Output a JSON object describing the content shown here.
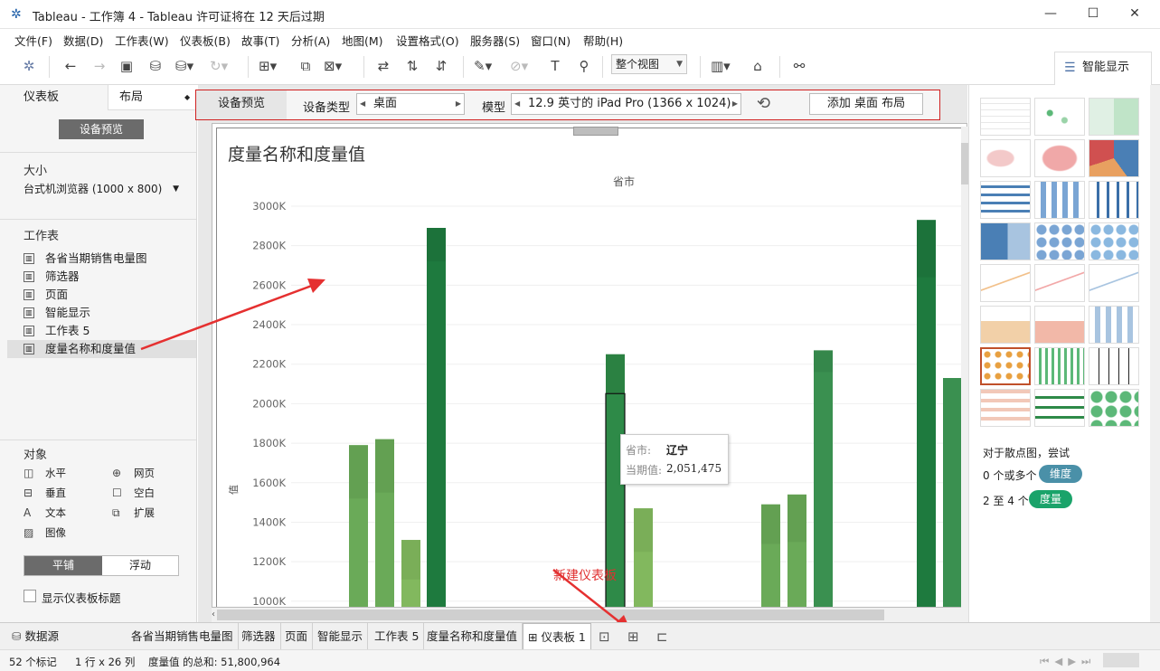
{
  "window": {
    "title": "Tableau - 工作簿 4 - Tableau 许可证将在 12 天后过期",
    "minimize": "—",
    "maximize": "☐",
    "close": "✕"
  },
  "menu": [
    "文件(F)",
    "数据(D)",
    "工作表(W)",
    "仪表板(B)",
    "故事(T)",
    "分析(A)",
    "地图(M)",
    "设置格式(O)",
    "服务器(S)",
    "窗口(N)",
    "帮助(H)"
  ],
  "toolbar": {
    "fit_label": "整个视图",
    "show_me_label": "智能显示"
  },
  "left_panel": {
    "tab_dashboard": "仪表板",
    "tab_layout": "布局",
    "device_preview_button": "设备预览",
    "size_heading": "大小",
    "size_value": "台式机浏览器 (1000 x 800)",
    "sheets_heading": "工作表",
    "sheets": [
      "各省当期销售电量图",
      "筛选器",
      "页面",
      "智能显示",
      "工作表 5",
      "度量名称和度量值"
    ],
    "objects_heading": "对象",
    "objects": [
      {
        "label": "水平",
        "icon": "horizontal-icon"
      },
      {
        "label": "网页",
        "icon": "web-icon"
      },
      {
        "label": "垂直",
        "icon": "vertical-icon"
      },
      {
        "label": "空白",
        "icon": "blank-icon"
      },
      {
        "label": "文本",
        "icon": "text-icon"
      },
      {
        "label": "扩展",
        "icon": "extension-icon"
      },
      {
        "label": "图像",
        "icon": "image-icon"
      }
    ],
    "tiled": "平铺",
    "floating": "浮动",
    "show_title": "显示仪表板标题"
  },
  "device_bar": {
    "tab": "设备预览",
    "type_label": "设备类型",
    "type_value": "桌面",
    "model_label": "模型",
    "model_value": "12.9 英寸的 iPad Pro (1366 x 1024)",
    "add_layout": "添加 桌面 布局"
  },
  "chart": {
    "title": "度量名称和度量值",
    "header": "省市",
    "ylabel": "值",
    "tooltip_prov_label": "省市:",
    "tooltip_prov_value": "辽宁",
    "tooltip_val_label": "当期值:",
    "tooltip_val_value": "2,051,475"
  },
  "chart_data": {
    "type": "bar",
    "title": "度量名称和度量值",
    "xlabel": "省市",
    "ylabel": "值",
    "ylim": [
      1000,
      3000
    ],
    "yticks": [
      "3000K",
      "2800K",
      "2600K",
      "2400K",
      "2200K",
      "2000K",
      "1800K",
      "1600K",
      "1400K",
      "1200K",
      "1000K"
    ],
    "ytick_values": [
      3000,
      2800,
      2600,
      2400,
      2200,
      2000,
      1800,
      1600,
      1400,
      1200,
      1000
    ],
    "bars": [
      {
        "value": 1790,
        "value_lower": 1520,
        "color": "#6aaa58"
      },
      {
        "value": 1820,
        "value_lower": 1550,
        "color": "#6aaa58"
      },
      {
        "value": 1310,
        "value_lower": 1110,
        "color": "#82b85e"
      },
      {
        "value": 2890,
        "value_lower": 2720,
        "color": "#1e7a3e"
      },
      {
        "value": 2250,
        "value_lower": 2051,
        "color": "#2e8a48",
        "highlighted": true
      },
      {
        "value": 1470,
        "value_lower": 1250,
        "color": "#82b85e"
      },
      {
        "value": 1490,
        "value_lower": 1290,
        "color": "#6aaa58"
      },
      {
        "value": 1540,
        "value_lower": 1300,
        "color": "#6aaa58"
      },
      {
        "value": 2270,
        "value_lower": 2160,
        "color": "#3a9050"
      },
      {
        "value": 2930,
        "value_lower": 2640,
        "color": "#1e7a3e"
      },
      {
        "value": 2130,
        "value_lower": 2130,
        "color": "#3a9050"
      }
    ]
  },
  "right_panel": {
    "hint": "对于散点图，尝试",
    "dim_line": "0 个或多个",
    "dim_pill": "维度",
    "mea_line": "2 至 4 个",
    "mea_pill": "度量",
    "colors": {
      "dimension": "#4a90a8",
      "measure": "#1aa36a"
    }
  },
  "annotations": {
    "new_dashboard": "新建仪表板"
  },
  "bottom_tabs": {
    "datasource": "数据源",
    "sheets": [
      "各省当期销售电量图",
      "筛选器",
      "页面",
      "智能显示",
      "工作表 5",
      "度量名称和度量值"
    ],
    "active": "仪表板 1"
  },
  "status": {
    "marks": "52 个标记",
    "rows_cols": "1 行 x 26 列",
    "sum": "度量值 的总和: 51,800,964"
  }
}
